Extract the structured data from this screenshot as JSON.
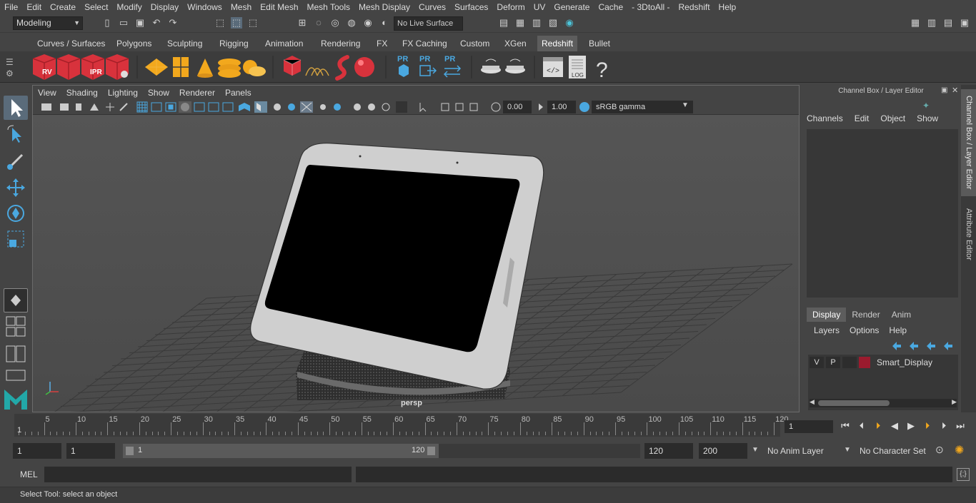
{
  "menubar": [
    "File",
    "Edit",
    "Create",
    "Select",
    "Modify",
    "Display",
    "Windows",
    "Mesh",
    "Edit Mesh",
    "Mesh Tools",
    "Mesh Display",
    "Curves",
    "Surfaces",
    "Deform",
    "UV",
    "Generate",
    "Cache",
    "- 3DtoAll -",
    "Redshift",
    "Help"
  ],
  "status": {
    "mode": "Modeling",
    "live_surface": "No Live Surface"
  },
  "shelf_tabs": [
    "Curves / Surfaces",
    "Polygons",
    "Sculpting",
    "Rigging",
    "Animation",
    "Rendering",
    "FX",
    "FX Caching",
    "Custom",
    "XGen",
    "Redshift",
    "Bullet"
  ],
  "active_shelf": "Redshift",
  "shelf_labels": {
    "rv": "RV",
    "ipr": "IPR",
    "pr": "PR",
    "log": "LOG",
    "help": "?"
  },
  "viewport": {
    "menu": [
      "View",
      "Shading",
      "Lighting",
      "Show",
      "Renderer",
      "Panels"
    ],
    "exposure": "0.00",
    "gamma": "1.00",
    "color_space": "sRGB gamma",
    "camera_label": "persp"
  },
  "channel_box": {
    "title": "Channel Box / Layer Editor",
    "menu": [
      "Channels",
      "Edit",
      "Object",
      "Show"
    ],
    "layer_tabs": [
      "Display",
      "Render",
      "Anim"
    ],
    "active_layer_tab": "Display",
    "layer_menu": [
      "Layers",
      "Options",
      "Help"
    ],
    "layers": [
      {
        "v": "V",
        "p": "P",
        "name": "Smart_Display",
        "color": "#9b1b2e"
      }
    ]
  },
  "side_tabs": [
    "Channel Box / Layer Editor",
    "Attribute Editor"
  ],
  "timeline": {
    "ticks": [
      5,
      10,
      15,
      20,
      25,
      30,
      35,
      40,
      45,
      50,
      55,
      60,
      65,
      70,
      75,
      80,
      85,
      90,
      95,
      100,
      105,
      110,
      115,
      120
    ],
    "start_label": "1",
    "current_frame": "1"
  },
  "range": {
    "start": "1",
    "playback_start": "1",
    "slider_start": "1",
    "slider_end": "120",
    "playback_end": "120",
    "end": "200",
    "anim_layer": "No Anim Layer",
    "character_set": "No Character Set"
  },
  "cmdline": {
    "label": "MEL"
  },
  "helpline": {
    "text": "Select Tool: select an object"
  }
}
